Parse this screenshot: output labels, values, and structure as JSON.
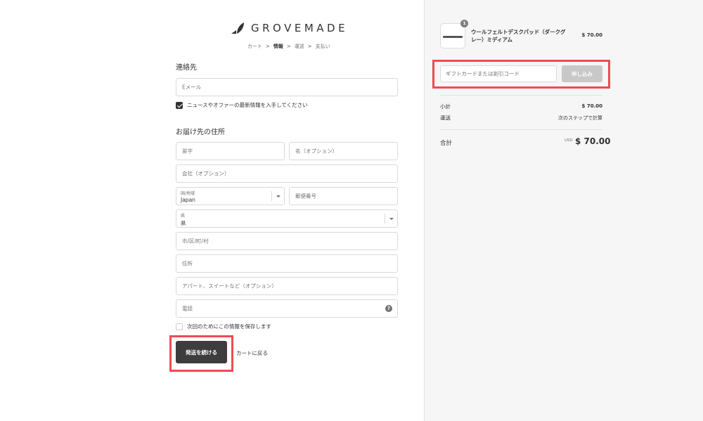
{
  "brand": {
    "logo_text": "GROVEMADE"
  },
  "breadcrumb": {
    "items": [
      "カート",
      "情報",
      "運送",
      "支払い"
    ],
    "current_index": 1,
    "separator": ">"
  },
  "contact": {
    "title": "連絡先",
    "email_placeholder": "Eメール",
    "newsletter_label": "ニュースやオファーの最新情報を入手してください",
    "newsletter_checked": true
  },
  "shipping": {
    "title": "お届け先の住所",
    "last_name_placeholder": "苗字",
    "first_name_placeholder": "名（オプション）",
    "company_placeholder": "会社（オプション）",
    "country_label": "国/地域",
    "country_value": "Japan",
    "postal_placeholder": "郵便番号",
    "prefecture_label": "県",
    "prefecture_value": "県",
    "city_placeholder": "市/区/町/村",
    "address_placeholder": "住所",
    "apartment_placeholder": "アパート、スイートなど（オプション）",
    "phone_placeholder": "電話",
    "save_info_label": "次回のためにこの情報を保存します",
    "save_info_checked": false
  },
  "actions": {
    "continue_label": "発送を続ける",
    "back_label": "カートに戻る"
  },
  "order": {
    "item": {
      "name": "ウールフェルトデスクパッド（ダークグレー）ミディアム",
      "quantity": "1",
      "price": "$ 70.00"
    },
    "discount_placeholder": "ギフトカードまたは割引コード",
    "apply_label": "申し込み",
    "subtotal_label": "小計",
    "subtotal_value": "$ 70.00",
    "shipping_label": "運送",
    "shipping_value": "次のステップで計算",
    "total_label": "合計",
    "total_currency": "USD",
    "total_value": "$ 70.00"
  },
  "colors": {
    "highlight": "#f04a55",
    "button_dark": "#3d3d3d",
    "sidebar_bg": "#f6f6f6"
  }
}
